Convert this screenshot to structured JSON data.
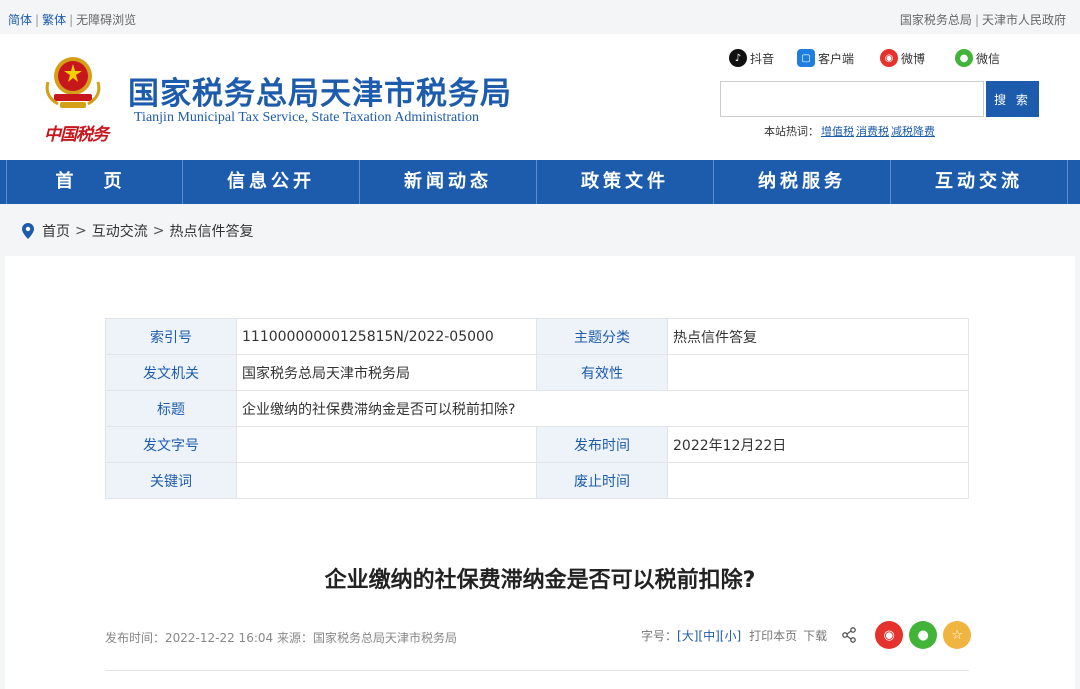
{
  "topbar": {
    "simplified": "简体",
    "traditional": "繁体",
    "accessible": "无障碍浏览",
    "link_sat": "国家税务总局",
    "link_gov": "天津市人民政府",
    "sep": "|"
  },
  "header": {
    "title": "国家税务总局天津市税务局",
    "subtitle": "Tianjin Municipal Tax Service, State Taxation Administration",
    "seal_text": "中国税务",
    "social": {
      "douyin": "抖音",
      "client": "客户端",
      "weibo": "微博",
      "wechat": "微信"
    },
    "search": {
      "value": "",
      "button": "搜 索"
    },
    "hotwords_label": "本站热词：",
    "hotwords": [
      "增值税",
      "消费税",
      "减税降费"
    ]
  },
  "nav": [
    "首 页",
    "信息公开",
    "新闻动态",
    "政策文件",
    "纳税服务",
    "互动交流"
  ],
  "breadcrumb": {
    "home": "首页",
    "level1": "互动交流",
    "current": "热点信件答复",
    "sep": ">"
  },
  "meta_table": {
    "index_label": "索引号",
    "index_value": "11100000000125815N/2022-05000",
    "topic_label": "主题分类",
    "topic_value": "热点信件答复",
    "issuer_label": "发文机关",
    "issuer_value": "国家税务总局天津市税务局",
    "validity_label": "有效性",
    "validity_value": "",
    "title_label": "标题",
    "title_value": "企业缴纳的社保费滞纳金是否可以税前扣除?",
    "docno_label": "发文字号",
    "docno_value": "",
    "pubdate_label": "发布时间",
    "pubdate_value": "2022年12月22日",
    "keywords_label": "关键词",
    "keywords_value": "",
    "expiry_label": "废止时间",
    "expiry_value": ""
  },
  "article": {
    "title": "企业缴纳的社保费滞纳金是否可以税前扣除?",
    "meta": "发布时间：2022-12-22 16:04  来源：国家税务总局天津市税务局",
    "font_label": "字号：",
    "font_large": "[大]",
    "font_medium": "[中]",
    "font_small": "[小]",
    "print": "打印本页",
    "download": "下载"
  },
  "colors": {
    "brand": "#1d5cad",
    "weibo": "#e6322d",
    "wechat": "#42b43a",
    "favorite": "#f0b440"
  }
}
